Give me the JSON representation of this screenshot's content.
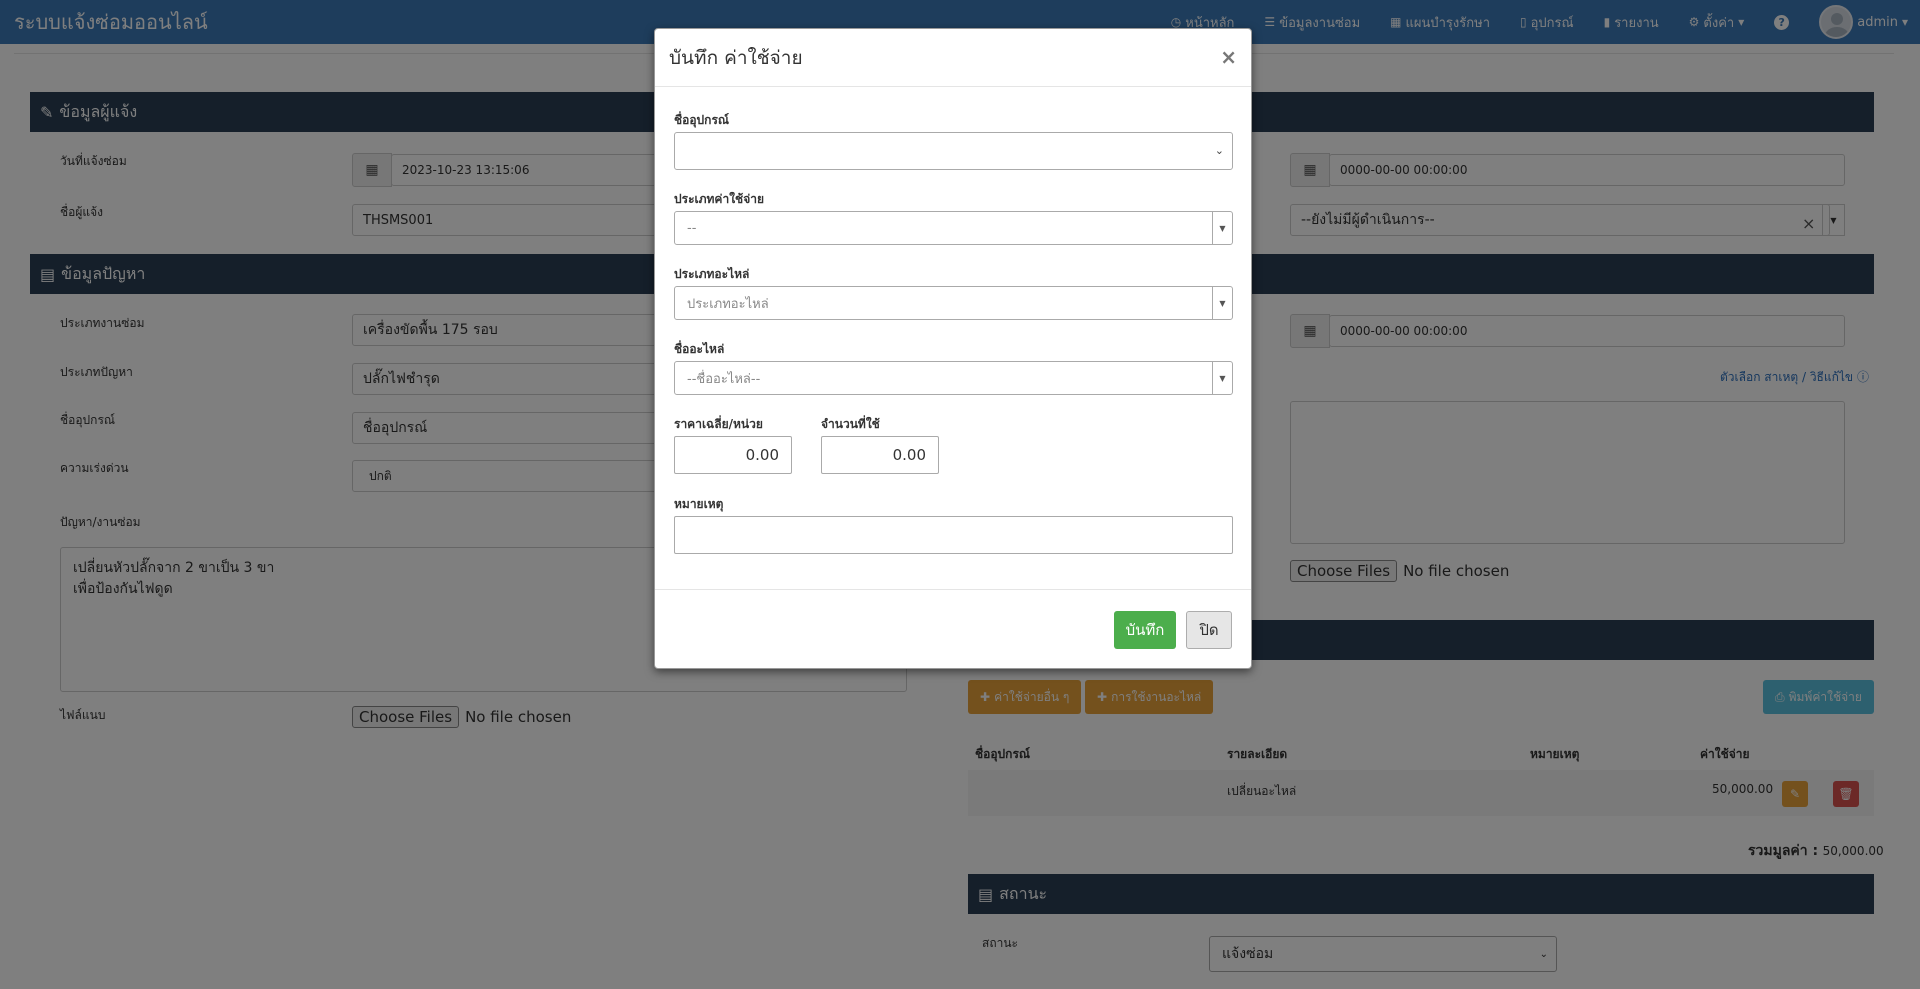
{
  "navbar": {
    "brand": "ระบบแจ้งซ่อมออนไลน์",
    "items": [
      {
        "icon": "clock-icon",
        "glyph": "◷",
        "label": "หน้าหลัก"
      },
      {
        "icon": "list-icon",
        "glyph": "☰",
        "label": "ข้อมูลงานซ่อม"
      },
      {
        "icon": "calendar-icon",
        "glyph": "▦",
        "label": "แผนบำรุงรักษา"
      },
      {
        "icon": "mobile-icon",
        "glyph": "▯",
        "label": "อุปกรณ์"
      },
      {
        "icon": "bar-chart-icon",
        "glyph": "▮",
        "label": "รายงาน"
      },
      {
        "icon": "gear-icon",
        "glyph": "⚙",
        "label": "ตั้งค่า"
      }
    ],
    "help_glyph": "?",
    "user": "admin"
  },
  "reporter_section": {
    "title": "ข้อมูลผู้แจ้ง",
    "date_label": "วันที่แจ้งซ่อม",
    "date_value": "2023-10-23 13:15:06",
    "reporter_label": "ชื่อผู้แจ้ง",
    "reporter_value": "THSMS001",
    "right_date_value": "0000-00-00 00:00:00",
    "handler_value": "--ยังไม่มีผู้ดำเนินการ--"
  },
  "problem_section": {
    "title": "ข้อมูลปัญหา",
    "job_type_label": "ประเภทงานซ่อม",
    "job_type_value": "เครื่องขัดพื้น 175 รอบ",
    "problem_type_label": "ประเภทปัญหา",
    "problem_type_value": "ปลั๊กไฟชำรุด",
    "device_label": "ชื่ออุปกรณ์",
    "device_placeholder": "ชื่ออุปกรณ์",
    "urgency_label": "ความเร่งด่วน",
    "urgency_value": "ปกติ",
    "detail_label": "ปัญหา/งานซ่อม",
    "detail_line1": "เปลี่ยนหัวปลั๊กจาก 2 ขาเป็น 3 ขา",
    "detail_line2": "เพื่อป้องกันไฟดูด",
    "attach_label": "ไฟล์แนบ",
    "right_date_value": "0000-00-00 00:00:00",
    "options_link": "ตัวเลือก สาเหตุ / วิธีแก้ไข"
  },
  "file_input": {
    "button": "Choose Files",
    "status": "No file chosen"
  },
  "expenses": {
    "add_other_button": "ค่าใช้จ่ายอื่น ๆ",
    "add_parts_button": "การใช้งานอะไหล่",
    "print_button": "พิมพ์ค่าใช้จ่าย",
    "columns": {
      "device": "ชื่ออุปกรณ์",
      "detail": "รายละเอียด",
      "note": "หมายเหตุ",
      "cost": "ค่าใช้จ่าย"
    },
    "rows": [
      {
        "device": "",
        "detail": "เปลี่ยนอะไหล่",
        "note": "",
        "cost": "50,000.00"
      }
    ],
    "total_label": "รวมมูลค่า :",
    "total_value": "50,000.00"
  },
  "status_section": {
    "title": "สถานะ",
    "label": "สถานะ",
    "value": "แจ้งซ่อม"
  },
  "modal": {
    "title": "บันทึก ค่าใช้จ่าย",
    "close_glyph": "×",
    "device_label": "ชื่ออุปกรณ์",
    "expense_type_label": "ประเภทค่าใช้จ่าย",
    "expense_type_value": "--",
    "part_type_label": "ประเภทอะไหล่",
    "part_type_placeholder": "ประเภทอะไหล่",
    "part_name_label": "ชื่ออะไหล่",
    "part_name_placeholder": "--ชื่ออะไหล่--",
    "unit_price_label": "ราคาเฉลี่ย/หน่วย",
    "unit_price_value": "0.00",
    "qty_label": "จำนวนที่ใช้",
    "qty_value": "0.00",
    "note_label": "หมายเหตุ",
    "save_button": "บันทึก",
    "close_button": "ปิด"
  },
  "colors": {
    "navbar": "#3c7ab8",
    "section_header": "#2a3f54",
    "success": "#4cae4c",
    "warning": "#e8a23b",
    "info": "#5bc0de",
    "danger": "#d9534f"
  }
}
